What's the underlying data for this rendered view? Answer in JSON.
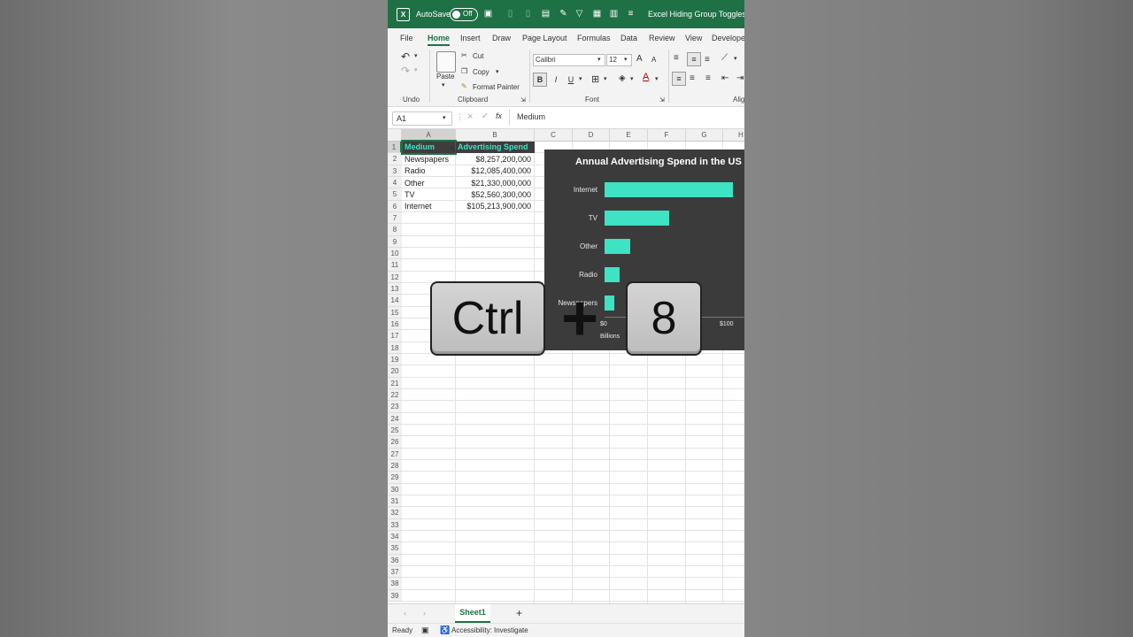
{
  "titlebar": {
    "autosave_label": "AutoSave",
    "autosave_state": "Off",
    "filename": "Excel Hiding Group Toggles.xlsx"
  },
  "menu": [
    "File",
    "Home",
    "Insert",
    "Draw",
    "Page Layout",
    "Formulas",
    "Data",
    "Review",
    "View",
    "Developer"
  ],
  "ribbon": {
    "undo_group": "Undo",
    "paste": "Paste",
    "cut": "Cut",
    "copy": "Copy",
    "format_painter": "Format Painter",
    "clipboard_group": "Clipboard",
    "font_name": "Calibri",
    "font_size": "12",
    "grow_font": "A",
    "shrink_font": "A",
    "bold": "B",
    "italic": "I",
    "underline": "U",
    "font_group": "Font",
    "align_group": "Alig"
  },
  "formula_bar": {
    "name_box": "A1",
    "fx": "fx",
    "value": "Medium"
  },
  "columns": [
    "A",
    "B",
    "C",
    "D",
    "E",
    "F",
    "G",
    "H"
  ],
  "rows": [
    "1",
    "2",
    "3",
    "4",
    "5",
    "6",
    "7",
    "8",
    "9",
    "10",
    "11",
    "12",
    "13",
    "14",
    "15",
    "16",
    "17",
    "18",
    "19",
    "20",
    "21",
    "22",
    "23",
    "24",
    "25",
    "26",
    "27",
    "28",
    "29",
    "30",
    "31",
    "32",
    "33",
    "34",
    "35",
    "36",
    "37",
    "38",
    "39"
  ],
  "table": {
    "headers": [
      "Medium",
      "Advertising Spend"
    ],
    "rows": [
      [
        "Newspapers",
        "$8,257,200,000"
      ],
      [
        "Radio",
        "$12,085,400,000"
      ],
      [
        "Other",
        "$21,330,000,000"
      ],
      [
        "TV",
        "$52,560,300,000"
      ],
      [
        "Internet",
        "$105,213,900,000"
      ]
    ]
  },
  "chart_data": {
    "type": "bar",
    "orientation": "horizontal",
    "title": "Annual Advertising Spend in the US",
    "categories": [
      "Internet",
      "TV",
      "Other",
      "Radio",
      "Newspapers"
    ],
    "values": [
      105.2139,
      52.5603,
      21.33,
      12.0854,
      8.2572
    ],
    "xlabel": "Billions",
    "x_ticks": [
      "$0",
      "$100"
    ],
    "xlim": [
      0,
      100
    ],
    "bar_color": "#3de3c3",
    "background": "#3b3b3b"
  },
  "overlay": {
    "key1": "Ctrl",
    "plus": "+",
    "key2": "8"
  },
  "sheet_tabs": {
    "active": "Sheet1",
    "add": "+"
  },
  "status": {
    "ready": "Ready",
    "accessibility": "Accessibility: Investigate"
  },
  "colors": {
    "excel_green": "#1e7145",
    "header_fill": "#3d3d3d",
    "header_text": "#3de3c3"
  }
}
